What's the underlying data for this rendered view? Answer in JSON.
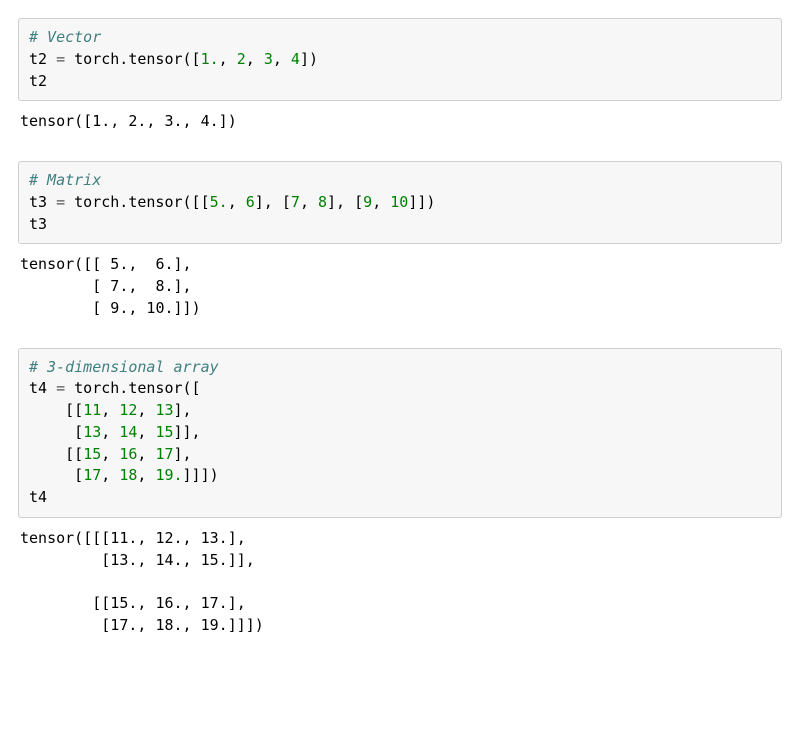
{
  "cells": [
    {
      "type": "input",
      "tokens": [
        {
          "cls": "cm",
          "t": "# Vector"
        },
        {
          "cls": "br"
        },
        {
          "cls": "nm",
          "t": "t2 "
        },
        {
          "cls": "op",
          "t": "="
        },
        {
          "cls": "nm",
          "t": " torch.tensor(["
        },
        {
          "cls": "num",
          "t": "1."
        },
        {
          "cls": "nm",
          "t": ", "
        },
        {
          "cls": "num",
          "t": "2"
        },
        {
          "cls": "nm",
          "t": ", "
        },
        {
          "cls": "num",
          "t": "3"
        },
        {
          "cls": "nm",
          "t": ", "
        },
        {
          "cls": "num",
          "t": "4"
        },
        {
          "cls": "nm",
          "t": "])"
        },
        {
          "cls": "br"
        },
        {
          "cls": "nm",
          "t": "t2"
        }
      ]
    },
    {
      "type": "output",
      "text": "tensor([1., 2., 3., 4.])"
    },
    {
      "type": "input",
      "tokens": [
        {
          "cls": "cm",
          "t": "# Matrix"
        },
        {
          "cls": "br"
        },
        {
          "cls": "nm",
          "t": "t3 "
        },
        {
          "cls": "op",
          "t": "="
        },
        {
          "cls": "nm",
          "t": " torch.tensor([["
        },
        {
          "cls": "num",
          "t": "5."
        },
        {
          "cls": "nm",
          "t": ", "
        },
        {
          "cls": "num",
          "t": "6"
        },
        {
          "cls": "nm",
          "t": "], ["
        },
        {
          "cls": "num",
          "t": "7"
        },
        {
          "cls": "nm",
          "t": ", "
        },
        {
          "cls": "num",
          "t": "8"
        },
        {
          "cls": "nm",
          "t": "], ["
        },
        {
          "cls": "num",
          "t": "9"
        },
        {
          "cls": "nm",
          "t": ", "
        },
        {
          "cls": "num",
          "t": "10"
        },
        {
          "cls": "nm",
          "t": "]])"
        },
        {
          "cls": "br"
        },
        {
          "cls": "nm",
          "t": "t3"
        }
      ]
    },
    {
      "type": "output",
      "text": "tensor([[ 5.,  6.],\n        [ 7.,  8.],\n        [ 9., 10.]])"
    },
    {
      "type": "input",
      "tokens": [
        {
          "cls": "cm",
          "t": "# 3-dimensional array"
        },
        {
          "cls": "br"
        },
        {
          "cls": "nm",
          "t": "t4 "
        },
        {
          "cls": "op",
          "t": "="
        },
        {
          "cls": "nm",
          "t": " torch.tensor(["
        },
        {
          "cls": "br"
        },
        {
          "cls": "nm",
          "t": "    [["
        },
        {
          "cls": "num",
          "t": "11"
        },
        {
          "cls": "nm",
          "t": ", "
        },
        {
          "cls": "num",
          "t": "12"
        },
        {
          "cls": "nm",
          "t": ", "
        },
        {
          "cls": "num",
          "t": "13"
        },
        {
          "cls": "nm",
          "t": "],"
        },
        {
          "cls": "br"
        },
        {
          "cls": "nm",
          "t": "     ["
        },
        {
          "cls": "num",
          "t": "13"
        },
        {
          "cls": "nm",
          "t": ", "
        },
        {
          "cls": "num",
          "t": "14"
        },
        {
          "cls": "nm",
          "t": ", "
        },
        {
          "cls": "num",
          "t": "15"
        },
        {
          "cls": "nm",
          "t": "]],"
        },
        {
          "cls": "br"
        },
        {
          "cls": "nm",
          "t": "    [["
        },
        {
          "cls": "num",
          "t": "15"
        },
        {
          "cls": "nm",
          "t": ", "
        },
        {
          "cls": "num",
          "t": "16"
        },
        {
          "cls": "nm",
          "t": ", "
        },
        {
          "cls": "num",
          "t": "17"
        },
        {
          "cls": "nm",
          "t": "],"
        },
        {
          "cls": "br"
        },
        {
          "cls": "nm",
          "t": "     ["
        },
        {
          "cls": "num",
          "t": "17"
        },
        {
          "cls": "nm",
          "t": ", "
        },
        {
          "cls": "num",
          "t": "18"
        },
        {
          "cls": "nm",
          "t": ", "
        },
        {
          "cls": "num",
          "t": "19."
        },
        {
          "cls": "nm",
          "t": "]]])"
        },
        {
          "cls": "br"
        },
        {
          "cls": "nm",
          "t": "t4"
        }
      ]
    },
    {
      "type": "output",
      "text": "tensor([[[11., 12., 13.],\n         [13., 14., 15.]],\n\n        [[15., 16., 17.],\n         [17., 18., 19.]]])"
    }
  ]
}
